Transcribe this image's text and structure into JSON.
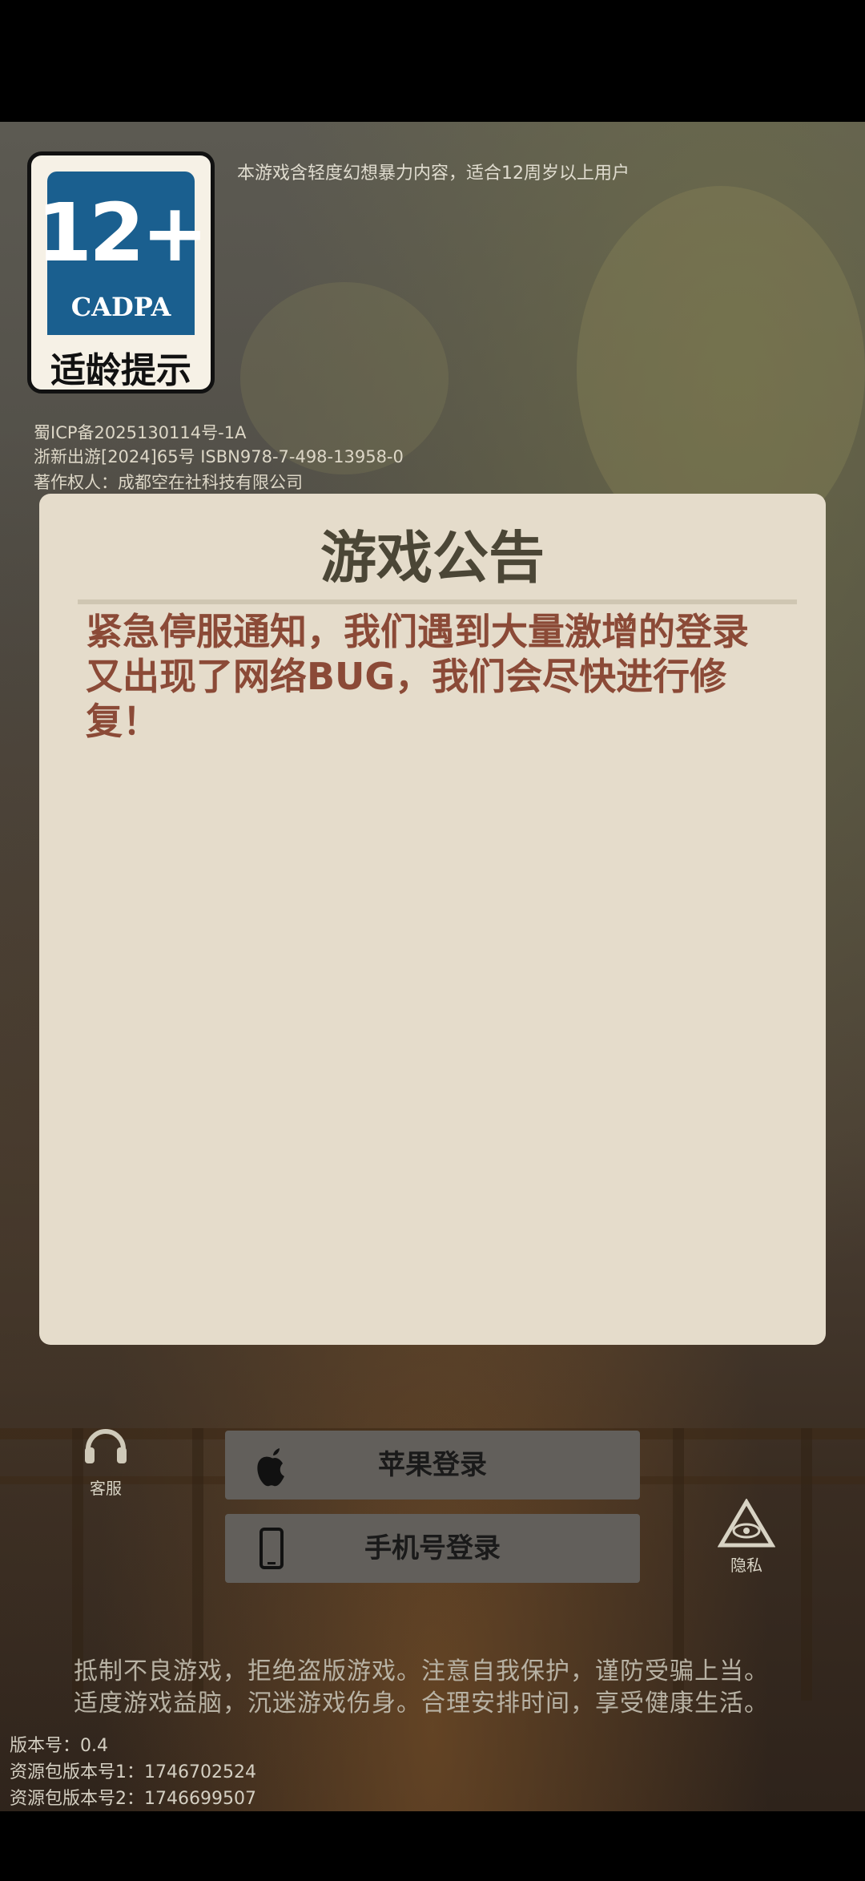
{
  "age_rating": {
    "age": "12+",
    "org": "CADPA",
    "label": "适龄提示"
  },
  "content_note": "本游戏含轻度幻想暴力内容，适合12周岁以上用户",
  "legal": {
    "icp": "蜀ICP备2025130114号-1A",
    "publish": "浙新出游[2024]65号 ISBN978-7-498-13958-0",
    "copyright": "著作权人：成都空在社科技有限公司"
  },
  "notice": {
    "title": "游戏公告",
    "body": "紧急停服通知，我们遇到大量激增的登录又出现了网络BUG，我们会尽快进行修复！"
  },
  "login": {
    "apple_label": "苹果登录",
    "phone_label": "手机号登录"
  },
  "side": {
    "service_label": "客服",
    "privacy_label": "隐私"
  },
  "slogan": {
    "line1": "抵制不良游戏，拒绝盗版游戏。注意自我保护，谨防受骗上当。",
    "line2": "适度游戏益脑，沉迷游戏伤身。合理安排时间，享受健康生活。"
  },
  "version": {
    "app": "版本号：0.4",
    "res1": "资源包版本号1：1746702524",
    "res2": "资源包版本号2：1746699507"
  }
}
